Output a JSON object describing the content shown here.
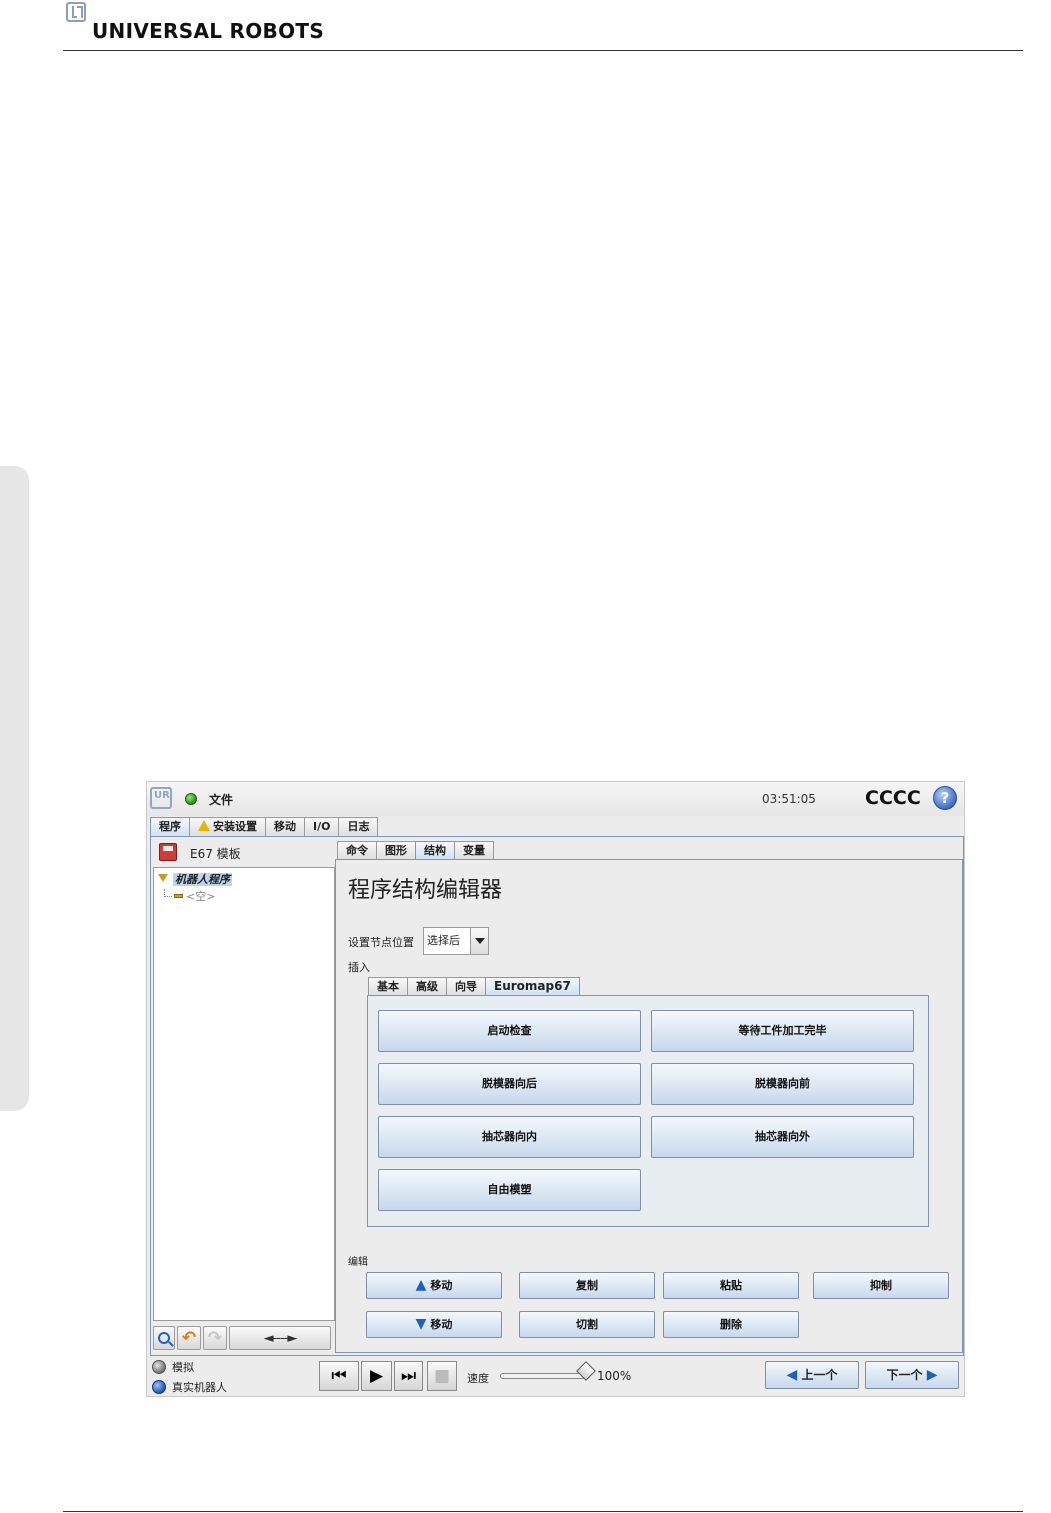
{
  "document": {
    "brand": "UNIVERSAL ROBOTS"
  },
  "app": {
    "file_menu": "文件",
    "clock": "03:51:05",
    "robot_name": "CCCC",
    "help": "?"
  },
  "main_tabs": [
    "程序",
    "安装设置",
    "移动",
    "I/O",
    "日志"
  ],
  "program": {
    "name": "E67 模板",
    "tree_root": "机器人程序",
    "tree_child": "<空>"
  },
  "tree_tools": {
    "move_arrows": "◄----►"
  },
  "sub_tabs": [
    "命令",
    "图形",
    "结构",
    "变量"
  ],
  "editor": {
    "title": "程序结构编辑器",
    "node_position_label": "设置节点位置",
    "node_position_value": "选择后",
    "insert_label": "插入"
  },
  "insert_tabs": [
    "基本",
    "高级",
    "向导",
    "Euromap67"
  ],
  "insert_buttons": [
    "启动检查",
    "等待工件加工完毕",
    "脱模器向后",
    "脱模器向前",
    "抽芯器向内",
    "抽芯器向外",
    "自由模塑"
  ],
  "edit": {
    "label": "编辑",
    "move_up": "移动",
    "move_down": "移动",
    "copy": "复制",
    "paste": "粘贴",
    "suppress": "抑制",
    "cut": "切割",
    "delete": "删除"
  },
  "bottom": {
    "simulation": "模拟",
    "real_robot": "真实机器人",
    "speed_label": "速度",
    "speed_value": "100%",
    "speed_fraction": 1.0,
    "prev": "上一个",
    "next": "下一个"
  },
  "icons": [
    "ur-logo-icon",
    "status-ok-icon",
    "help-icon",
    "warning-icon",
    "save-icon",
    "zoom-icon",
    "undo-icon",
    "redo-icon",
    "skip-back-icon",
    "play-icon",
    "step-icon",
    "stop-icon",
    "arrow-up-icon",
    "arrow-down-icon",
    "arrow-left-icon",
    "arrow-right-icon"
  ],
  "colors": {
    "tab_active": "#cfe0f2",
    "button": "#c7d8ec",
    "accent": "#1e5fbf",
    "warning": "#e8b400"
  }
}
